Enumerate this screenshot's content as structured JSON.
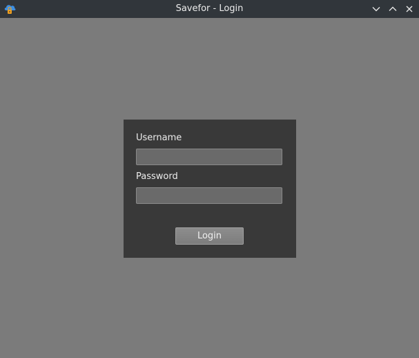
{
  "window": {
    "title": "Savefor - Login",
    "app_icon": "cloud-lock-icon",
    "controls": [
      "minimize-icon",
      "maximize-icon",
      "close-icon"
    ]
  },
  "login_form": {
    "username_label": "Username",
    "username_value": "",
    "password_label": "Password",
    "password_value": "",
    "login_button_label": "Login"
  },
  "colors": {
    "titlebar": "#31363b",
    "background": "#7b7b7b",
    "panel": "#393939",
    "accent_icon": "#3d8ee0"
  }
}
